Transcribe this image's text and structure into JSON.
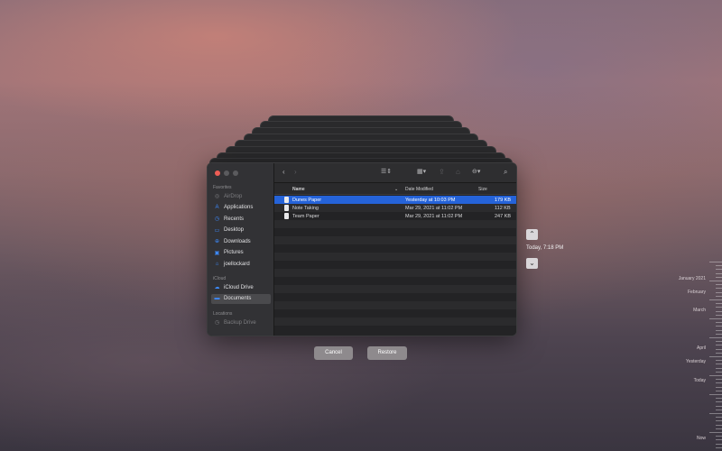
{
  "sidebar": {
    "favorites_label": "Favorites",
    "icloud_label": "iCloud",
    "locations_label": "Locations",
    "favorites": [
      {
        "label": "AirDrop",
        "icon": "airdrop-icon",
        "dim": true
      },
      {
        "label": "Applications",
        "icon": "applications-icon"
      },
      {
        "label": "Recents",
        "icon": "clock-icon"
      },
      {
        "label": "Desktop",
        "icon": "desktop-icon"
      },
      {
        "label": "Downloads",
        "icon": "downloads-icon"
      },
      {
        "label": "Pictures",
        "icon": "pictures-icon"
      },
      {
        "label": "joellockard",
        "icon": "home-icon"
      }
    ],
    "icloud": [
      {
        "label": "iCloud Drive",
        "icon": "cloud-icon"
      },
      {
        "label": "Documents",
        "icon": "folder-icon",
        "selected": true
      }
    ],
    "locations": [
      {
        "label": "Backup Drive",
        "icon": "clock-icon",
        "dim": true
      }
    ]
  },
  "columns": {
    "name": "Name",
    "date": "Date Modified",
    "size": "Size"
  },
  "files": [
    {
      "name": "Dunes Paper",
      "date": "Yesterday at 10:03 PM",
      "size": "179 KB",
      "selected": true
    },
    {
      "name": "Note Taking",
      "date": "Mar 29, 2021 at 11:02 PM",
      "size": "112 KB"
    },
    {
      "name": "Team Paper",
      "date": "Mar 29, 2021 at 11:02 PM",
      "size": "247 KB"
    }
  ],
  "buttons": {
    "cancel": "Cancel",
    "restore": "Restore"
  },
  "time_machine": {
    "current": "Today, 7:18 PM"
  },
  "timeline": {
    "labels": [
      "January 2021",
      "February",
      "March",
      "April",
      "Yesterday",
      "Today",
      "Now"
    ]
  },
  "colors": {
    "selection": "#2563d9",
    "close": "#ee5d55"
  }
}
